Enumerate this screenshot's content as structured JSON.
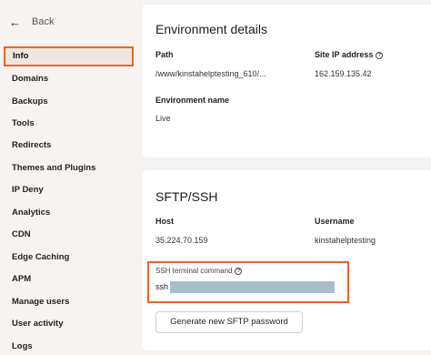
{
  "sidebar": {
    "back_label": "Back",
    "items": [
      {
        "label": "Info"
      },
      {
        "label": "Domains"
      },
      {
        "label": "Backups"
      },
      {
        "label": "Tools"
      },
      {
        "label": "Redirects"
      },
      {
        "label": "Themes and Plugins"
      },
      {
        "label": "IP Deny"
      },
      {
        "label": "Analytics"
      },
      {
        "label": "CDN"
      },
      {
        "label": "Edge Caching"
      },
      {
        "label": "APM"
      },
      {
        "label": "Manage users"
      },
      {
        "label": "User activity"
      },
      {
        "label": "Logs"
      }
    ],
    "active_item": "Info"
  },
  "environment": {
    "title": "Environment details",
    "path_label": "Path",
    "path_value": "/www/kinstahelptesting_610/...",
    "site_ip_label": "Site IP address",
    "site_ip_value": "162.159.135.42",
    "env_name_label": "Environment name",
    "env_name_value": "Live"
  },
  "sftp": {
    "title": "SFTP/SSH",
    "host_label": "Host",
    "host_value": "35.224.70.159",
    "username_label": "Username",
    "username_value": "kinstahelptesting",
    "ssh_label": "SSH terminal command",
    "ssh_prefix": "ssh",
    "generate_button": "Generate new SFTP password"
  },
  "colors": {
    "highlight": "#f1612a",
    "redaction": "#a8bfcb",
    "sidebar_bg": "#f7f3f0"
  },
  "icons": {
    "back": "arrow-left-icon",
    "help": "question-circle-icon"
  }
}
